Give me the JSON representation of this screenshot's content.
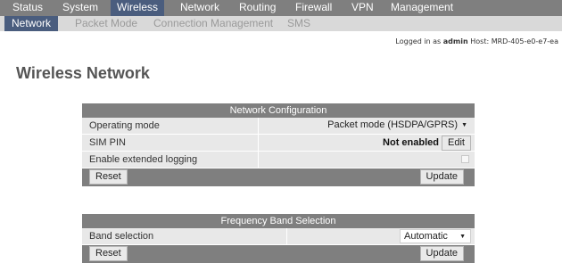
{
  "topnav": {
    "items": [
      {
        "label": "Status"
      },
      {
        "label": "System"
      },
      {
        "label": "Wireless"
      },
      {
        "label": "Network"
      },
      {
        "label": "Routing"
      },
      {
        "label": "Firewall"
      },
      {
        "label": "VPN"
      },
      {
        "label": "Management"
      }
    ],
    "active": "Wireless"
  },
  "subnav": {
    "items": [
      {
        "label": "Network"
      },
      {
        "label": "Packet Mode"
      },
      {
        "label": "Connection Management"
      },
      {
        "label": "SMS"
      }
    ],
    "active": "Network"
  },
  "login": {
    "prefix": "Logged in as",
    "user": "admin",
    "host_label": "Host:",
    "host": "MRD-405-e0-e7-ea"
  },
  "page_title": "Wireless Network",
  "network_config": {
    "title": "Network Configuration",
    "operating_mode_label": "Operating mode",
    "operating_mode_value": "Packet mode (HSDPA/GPRS)",
    "sim_pin_label": "SIM PIN",
    "sim_pin_status": "Not enabled",
    "edit_label": "Edit",
    "extended_logging_label": "Enable extended logging",
    "extended_logging_checked": false,
    "reset_label": "Reset",
    "update_label": "Update"
  },
  "band_selection": {
    "title": "Frequency Band Selection",
    "band_label": "Band selection",
    "band_value": "Automatic",
    "reset_label": "Reset",
    "update_label": "Update"
  },
  "colors": {
    "nav_bg": "#7f7f7f",
    "active_bg": "#4a5d7e",
    "subnav_bg": "#d9d9d9",
    "row_bg": "#e8e8e8"
  }
}
